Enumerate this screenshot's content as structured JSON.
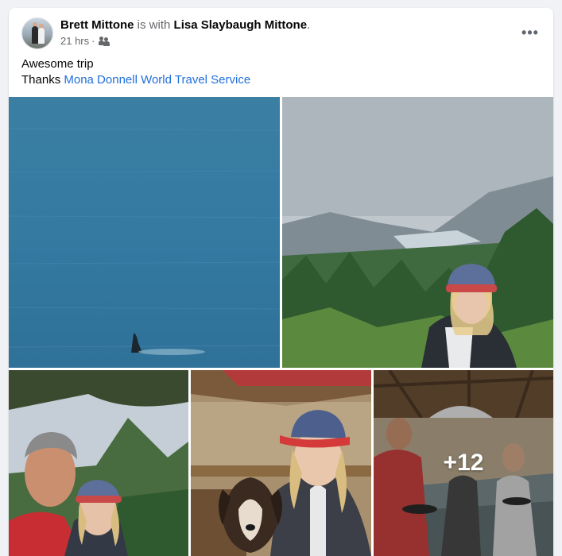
{
  "post": {
    "author": "Brett Mittone",
    "with_text": "is with",
    "tagged": "Lisa Slaybaugh Mittone",
    "period": ".",
    "timestamp": "21 hrs",
    "separator": "·",
    "audience_icon": "friends-icon",
    "more_icon": "more-options-icon",
    "more_label": "•••",
    "text_line1": "Awesome trip",
    "text_line2_prefix": "Thanks ",
    "tagged_page": "Mona Donnell World Travel Service"
  },
  "photos": {
    "items": [
      {
        "description_icon": "ocean-photo"
      },
      {
        "description_icon": "mountain-photo"
      },
      {
        "description_icon": "selfie-photo"
      },
      {
        "description_icon": "puppy-photo"
      },
      {
        "description_icon": "gold-panning-photo"
      }
    ],
    "more_count": "+12"
  },
  "colors": {
    "link": "#216fdb",
    "secondary_text": "#65676b",
    "background": "#f0f2f5"
  }
}
